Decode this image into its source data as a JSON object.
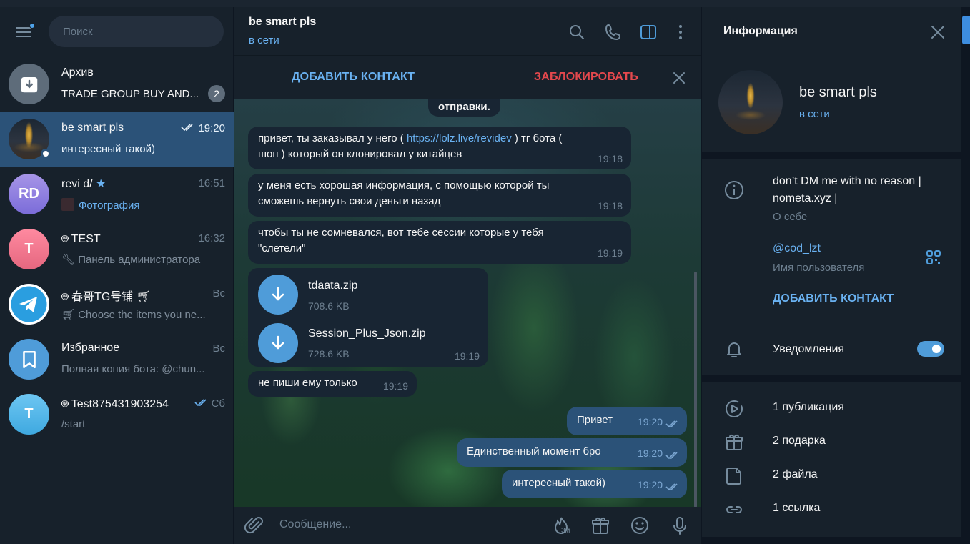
{
  "sidebar": {
    "search_placeholder": "Поиск",
    "chats": [
      {
        "name": "Архив",
        "preview": "TRADE GROUP BUY AND...",
        "badge": "2"
      },
      {
        "name": "be smart pls",
        "time": "19:20",
        "preview": "интересный такой)"
      },
      {
        "name": "revi d/",
        "initials": "RD",
        "time": "16:51",
        "preview": "Фотография"
      },
      {
        "name": "TEST",
        "initial": "T",
        "time": "16:32",
        "preview": "Панель администратора"
      },
      {
        "name": "春哥TG号铺",
        "time": "Вс",
        "preview": "Choose the items you ne..."
      },
      {
        "name": "Избранное",
        "time": "Вс",
        "preview": "Полная копия бота: @chun..."
      },
      {
        "name": "Test875431903254",
        "initial": "T",
        "time": "Сб",
        "preview": "/start"
      }
    ]
  },
  "chat": {
    "title": "be smart pls",
    "status": "в сети",
    "add_contact": "ДОБАВИТЬ КОНТАКТ",
    "block": "ЗАБЛОКИРОВАТЬ",
    "partial_top": "отправки.",
    "messages": [
      {
        "text_pre": "привет, ты заказывал у него ( ",
        "link": "https://lolz.live/revidev",
        "text_post": " ) тг бота (",
        "text_line2": "шоп ) который он клонировал у китайцев",
        "time": "19:18"
      },
      {
        "text": "у меня есть хорошая информация, с помощью которой ты",
        "text_line2": "сможешь вернуть свои деньги назад",
        "time": "19:18"
      },
      {
        "text": "чтобы ты не сомневался, вот тебе сессии которые у тебя",
        "text_line2": "\"слетели\"",
        "time": "19:19"
      },
      {
        "text": "не пиши ему только",
        "time": "19:19"
      }
    ],
    "files": [
      {
        "name": "tdaata.zip",
        "size": "708.6 KB"
      },
      {
        "name": "Session_Plus_Json.zip",
        "size": "728.6 KB",
        "time": "19:19"
      }
    ],
    "outgoing": [
      {
        "text": "Привет",
        "time": "19:20"
      },
      {
        "text": "Единственный момент бро",
        "time": "19:20"
      },
      {
        "text": "интересный такой)",
        "time": "19:20"
      }
    ],
    "composer_placeholder": "Сообщение...",
    "timer_label": "3м"
  },
  "panel": {
    "title": "Информация",
    "name": "be smart pls",
    "status": "в сети",
    "bio_line1": "don’t DM me with no reason |",
    "bio_line2": "nometa.xyz |",
    "bio_label": "О себе",
    "username": "@cod_lzt",
    "username_label": "Имя пользователя",
    "add_contact": "ДОБАВИТЬ КОНТАКТ",
    "notifications": "Уведомления",
    "notifications_on": true,
    "stats": [
      {
        "label": "1 публикация",
        "icon": "stories-icon"
      },
      {
        "label": "2 подарка",
        "icon": "gift-icon"
      },
      {
        "label": "2 файла",
        "icon": "file-icon"
      },
      {
        "label": "1 ссылка",
        "icon": "link-icon"
      }
    ]
  },
  "colors": {
    "accent": "#6ab2f2",
    "danger": "#e5484d",
    "active_chat": "#2b5278",
    "outgoing_bubble": "#2b5278",
    "incoming_bubble": "#182533"
  }
}
